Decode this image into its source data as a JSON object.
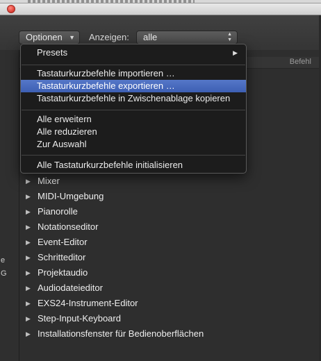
{
  "toolbar": {
    "optionen_label": "Optionen",
    "anzeigen_label": "Anzeigen:",
    "anzeigen_value": "alle"
  },
  "list": {
    "column_header": "Befehl",
    "rows": [
      "Mixer",
      "MIDI-Umgebung",
      "Pianorolle",
      "Notationseditor",
      "Event-Editor",
      "Schritteditor",
      "Projektaudio",
      "Audiodateieditor",
      "EXS24-Instrument-Editor",
      "Step-Input-Keyboard",
      "Installationsfenster für Bedienoberflächen"
    ]
  },
  "left_fragments": [
    "e",
    "G"
  ],
  "menu": {
    "presets": "Presets",
    "group1": [
      "Tastaturkurzbefehle importieren …",
      "Tastaturkurzbefehle exportieren …",
      "Tastaturkurzbefehle in Zwischenablage kopieren"
    ],
    "group2": [
      "Alle erweitern",
      "Alle reduzieren",
      "Zur Auswahl"
    ],
    "reset": "Alle Tastaturkurzbefehle initialisieren"
  },
  "colors": {
    "selection": "#4a6bbf",
    "close_button": "#e0443a"
  }
}
